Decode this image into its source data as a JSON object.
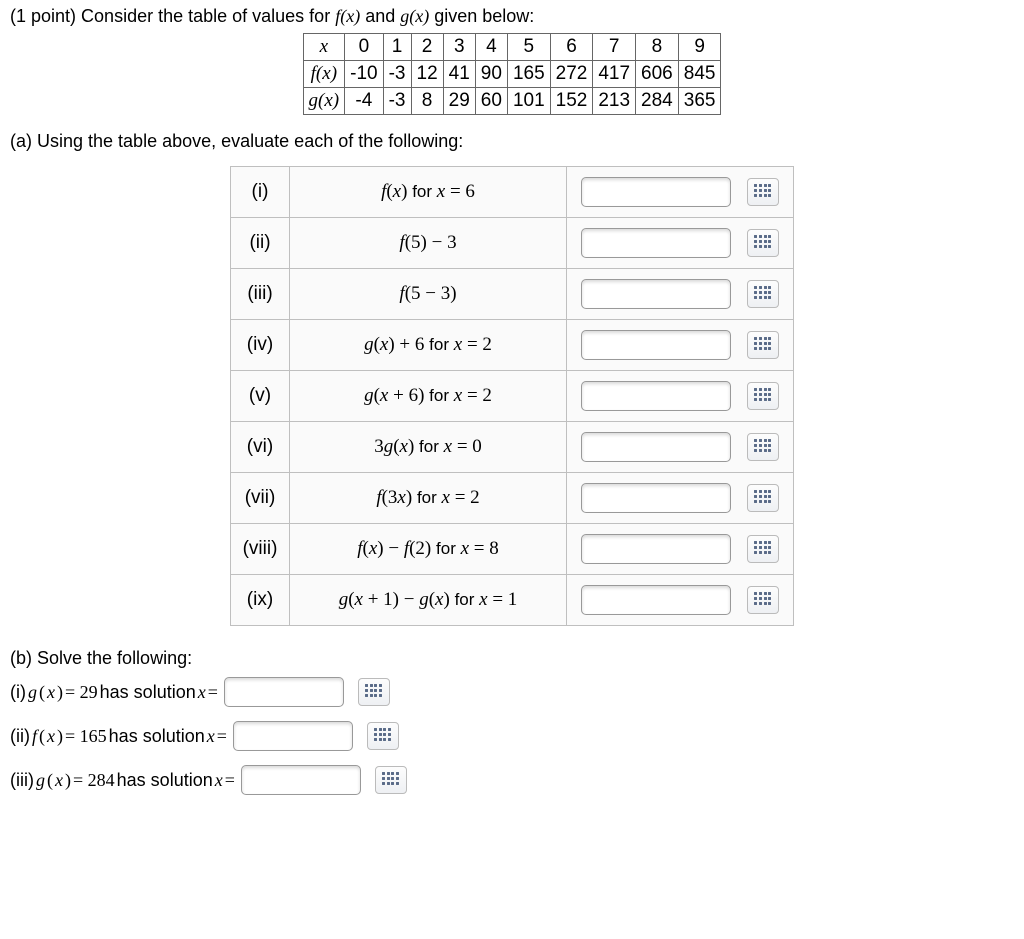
{
  "intro": {
    "points": "(1 point)",
    "text_before": " Consider the table of values for ",
    "f": "f(x)",
    "and": " and ",
    "g": "g(x)",
    "text_after": " given below:"
  },
  "value_table": {
    "x_label": "x",
    "f_label": "f(x)",
    "g_label": "g(x)",
    "x": [
      "0",
      "1",
      "2",
      "3",
      "4",
      "5",
      "6",
      "7",
      "8",
      "9"
    ],
    "f": [
      "-10",
      "-3",
      "12",
      "41",
      "90",
      "165",
      "272",
      "417",
      "606",
      "845"
    ],
    "g": [
      "-4",
      "-3",
      "8",
      "29",
      "60",
      "101",
      "152",
      "213",
      "284",
      "365"
    ]
  },
  "partA": {
    "label": "(a) Using the table above, evaluate each of the following:",
    "rows": [
      {
        "roman": "(i)",
        "expr_html": "<span class='math'>f</span><span class='mathrm'>(</span><span class='math'>x</span><span class='mathrm'>)</span> <span style='font-family:Arial;font-style:normal;font-size:17px'>for</span> <span class='math'>x</span> <span class='mathrm'>= 6</span>"
      },
      {
        "roman": "(ii)",
        "expr_html": "<span class='math'>f</span><span class='mathrm'>(5) − 3</span>"
      },
      {
        "roman": "(iii)",
        "expr_html": "<span class='math'>f</span><span class='mathrm'>(5 − 3)</span>"
      },
      {
        "roman": "(iv)",
        "expr_html": "<span class='math'>g</span><span class='mathrm'>(</span><span class='math'>x</span><span class='mathrm'>) + 6</span> <span style='font-family:Arial;font-style:normal;font-size:17px'>for</span> <span class='math'>x</span> <span class='mathrm'>= 2</span>"
      },
      {
        "roman": "(v)",
        "expr_html": "<span class='math'>g</span><span class='mathrm'>(</span><span class='math'>x</span> <span class='mathrm'>+ 6)</span> <span style='font-family:Arial;font-style:normal;font-size:17px'>for</span> <span class='math'>x</span> <span class='mathrm'>= 2</span>"
      },
      {
        "roman": "(vi)",
        "expr_html": "<span class='mathrm'>3</span><span class='math'>g</span><span class='mathrm'>(</span><span class='math'>x</span><span class='mathrm'>)</span> <span style='font-family:Arial;font-style:normal;font-size:17px'>for</span> <span class='math'>x</span> <span class='mathrm'>= 0</span>"
      },
      {
        "roman": "(vii)",
        "expr_html": "<span class='math'>f</span><span class='mathrm'>(3</span><span class='math'>x</span><span class='mathrm'>)</span> <span style='font-family:Arial;font-style:normal;font-size:17px'>for</span> <span class='math'>x</span> <span class='mathrm'>= 2</span>"
      },
      {
        "roman": "(viii)",
        "expr_html": "<span class='math'>f</span><span class='mathrm'>(</span><span class='math'>x</span><span class='mathrm'>) − </span><span class='math'>f</span><span class='mathrm'>(2)</span> <span style='font-family:Arial;font-style:normal;font-size:17px'>for</span> <span class='math'>x</span> <span class='mathrm'>= 8</span>"
      },
      {
        "roman": "(ix)",
        "expr_html": "<span class='math'>g</span><span class='mathrm'>(</span><span class='math'>x</span> <span class='mathrm'>+ 1) − </span><span class='math'>g</span><span class='mathrm'>(</span><span class='math'>x</span><span class='mathrm'>)</span> <span style='font-family:Arial;font-style:normal;font-size:17px'>for</span> <span class='math'>x</span> <span class='mathrm'>= 1</span>"
      }
    ]
  },
  "partB": {
    "label": "(b) Solve the following:",
    "lines": [
      {
        "roman": "(i)",
        "lhs": "g(x)",
        "eq": "= 29",
        "tail": " has solution ",
        "xeq": "x ="
      },
      {
        "roman": "(ii)",
        "lhs": "f(x)",
        "eq": "= 165",
        "tail": " has solution ",
        "xeq": "x ="
      },
      {
        "roman": "(iii)",
        "lhs": "g(x)",
        "eq": "= 284",
        "tail": " has solution ",
        "xeq": "x ="
      }
    ]
  }
}
